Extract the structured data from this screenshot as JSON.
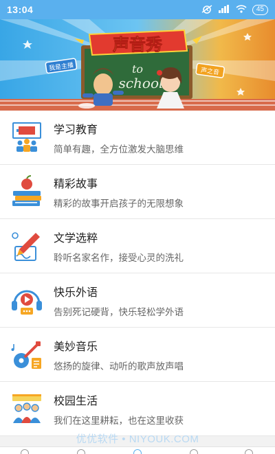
{
  "status_bar": {
    "time": "13:04",
    "battery": "45"
  },
  "banner": {
    "logo_text": "声音秀",
    "board_line1": "to",
    "board_line2": "school",
    "left_sign": "我是主播",
    "right_sign": "声之音"
  },
  "items": [
    {
      "title": "学习教育",
      "subtitle": "简单有趣，全方位激发大脑思维",
      "icon": "classroom-icon"
    },
    {
      "title": "精彩故事",
      "subtitle": "精彩的故事开启孩子的无限想象",
      "icon": "books-apple-icon"
    },
    {
      "title": "文学选粹",
      "subtitle": "聆听名家名作，接受心灵的洗礼",
      "icon": "pen-writing-icon"
    },
    {
      "title": "快乐外语",
      "subtitle": "告别死记硬背，快乐轻松学外语",
      "icon": "headphones-icon"
    },
    {
      "title": "美妙音乐",
      "subtitle": "悠扬的旋律、动听的歌声放声唱",
      "icon": "guitar-music-icon"
    },
    {
      "title": "校园生活",
      "subtitle": "我们在这里耕耘，也在这里收获",
      "icon": "students-banner-icon"
    }
  ],
  "watermark": "优优软件 • NIYOUK.COM",
  "colors": {
    "status_bar": "#5ab0ee",
    "accent": "#e04b3f",
    "icon_blue": "#3a8fd9"
  }
}
